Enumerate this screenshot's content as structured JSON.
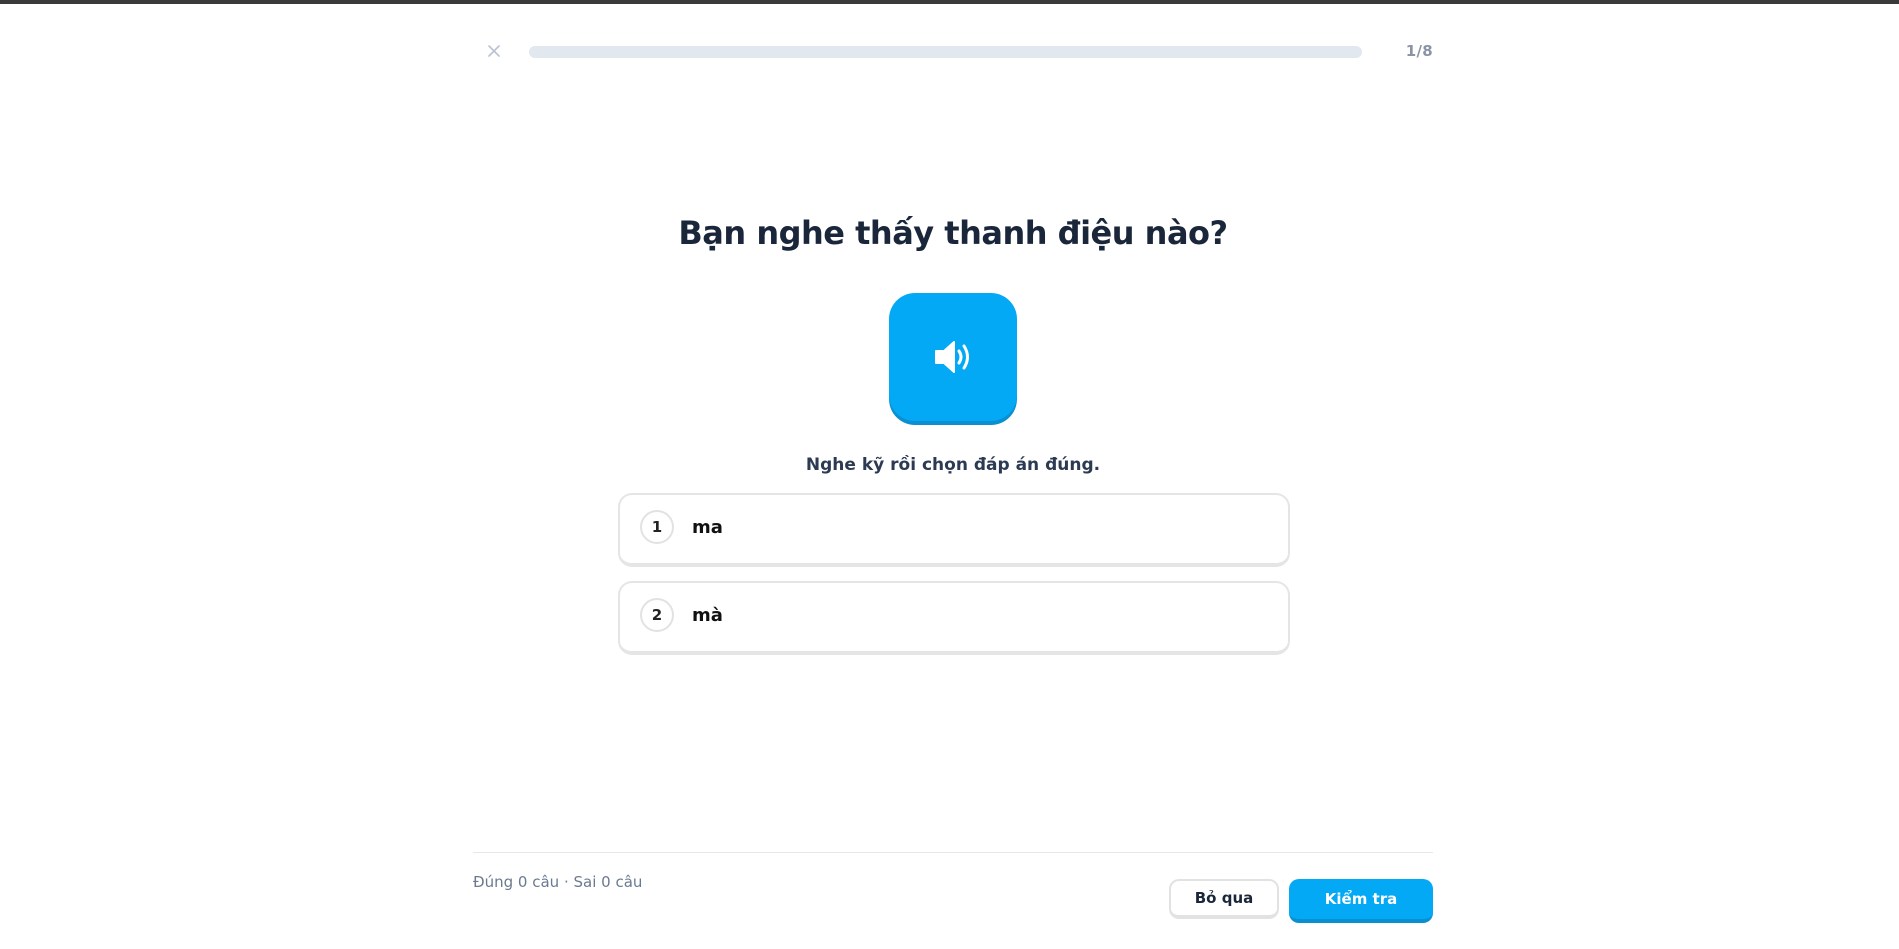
{
  "header": {
    "close_icon": "close-icon",
    "progress": {
      "current": 1,
      "total": 8,
      "fraction": 0.0
    },
    "counter_text": "1/8"
  },
  "question": {
    "title": "Bạn nghe thấy thanh điệu nào?",
    "audio_icon": "speaker-icon",
    "instruction": "Nghe kỹ rồi chọn đáp án đúng."
  },
  "options": [
    {
      "number": "1",
      "text": "ma"
    },
    {
      "number": "2",
      "text": "mà"
    }
  ],
  "footer": {
    "stats": "Đúng 0 câu · Sai 0 câu",
    "skip_label": "Bỏ qua",
    "check_label": "Kiểm tra"
  },
  "colors": {
    "accent": "#03a9f4",
    "title": "#1a2639",
    "progress_track": "#e2e8f0"
  }
}
